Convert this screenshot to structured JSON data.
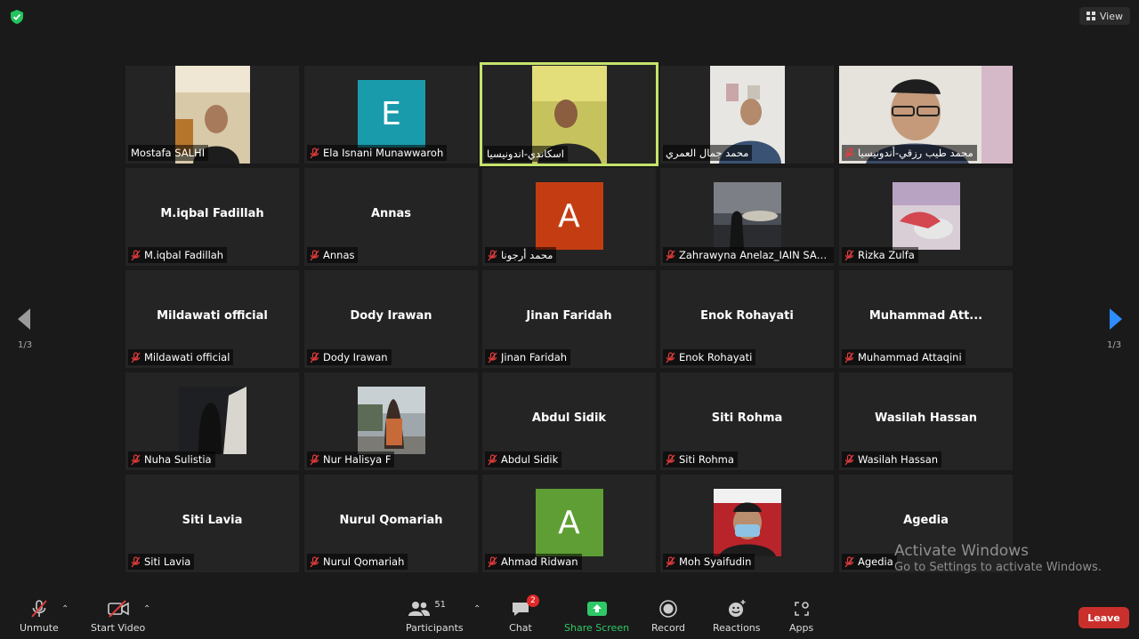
{
  "top": {
    "view_label": "View"
  },
  "pager": {
    "left_page": "1/3",
    "right_page": "1/3"
  },
  "tiles": [
    {
      "name": "Mostafa SALHI",
      "big": ""
    },
    {
      "name": "Ela Isnani Munawwaroh",
      "big": "",
      "avatar": "E",
      "avatar_color": "#1a9bab"
    },
    {
      "name": "اسكاندي-اندونيسيا",
      "big": ""
    },
    {
      "name": "محمد جمال العمري",
      "big": ""
    },
    {
      "name": "محمد طيب رزقي-أندونيسيا",
      "big": ""
    },
    {
      "name": "M.iqbal Fadillah",
      "big": "M.iqbal Fadillah"
    },
    {
      "name": "Annas",
      "big": "Annas"
    },
    {
      "name": "محمد أرجونا",
      "big": "",
      "avatar": "A",
      "avatar_color": "#c43d12"
    },
    {
      "name": "Zahrawyna Anelaz_IAIN SAS B...",
      "big": ""
    },
    {
      "name": "Rizka Zulfa",
      "big": ""
    },
    {
      "name": "Mildawati official",
      "big": "Mildawati official"
    },
    {
      "name": "Dody Irawan",
      "big": "Dody Irawan"
    },
    {
      "name": "Jinan Faridah",
      "big": "Jinan Faridah"
    },
    {
      "name": "Enok Rohayati",
      "big": "Enok Rohayati"
    },
    {
      "name": "Muhammad Attaqini",
      "big": "Muhammad  Att..."
    },
    {
      "name": "Nuha Sulistia",
      "big": ""
    },
    {
      "name": "Nur Halisya F",
      "big": ""
    },
    {
      "name": "Abdul Sidik",
      "big": "Abdul Sidik"
    },
    {
      "name": "Siti Rohma",
      "big": "Siti Rohma"
    },
    {
      "name": "Wasilah Hassan",
      "big": "Wasilah Hassan"
    },
    {
      "name": "Siti Lavia",
      "big": "Siti Lavia"
    },
    {
      "name": "Nurul Qomariah",
      "big": "Nurul Qomariah"
    },
    {
      "name": "Ahmad Ridwan",
      "big": "",
      "avatar": "A",
      "avatar_color": "#5e9e34"
    },
    {
      "name": "Moh Syaifudin",
      "big": ""
    },
    {
      "name": "Agedia",
      "big": "Agedia"
    }
  ],
  "toolbar": {
    "unmute": "Unmute",
    "start_video": "Start Video",
    "participants": "Participants",
    "participants_count": "51",
    "chat": "Chat",
    "chat_badge": "2",
    "share_screen": "Share Screen",
    "record": "Record",
    "reactions": "Reactions",
    "apps": "Apps",
    "leave": "Leave"
  },
  "watermark": {
    "line1": "Activate Windows",
    "line2": "Go to Settings to activate Windows."
  },
  "colors": {
    "active_speaker": "#c6e36a",
    "share_green": "#2ec866",
    "leave_red": "#c9302c",
    "badge_red": "#e02828"
  }
}
